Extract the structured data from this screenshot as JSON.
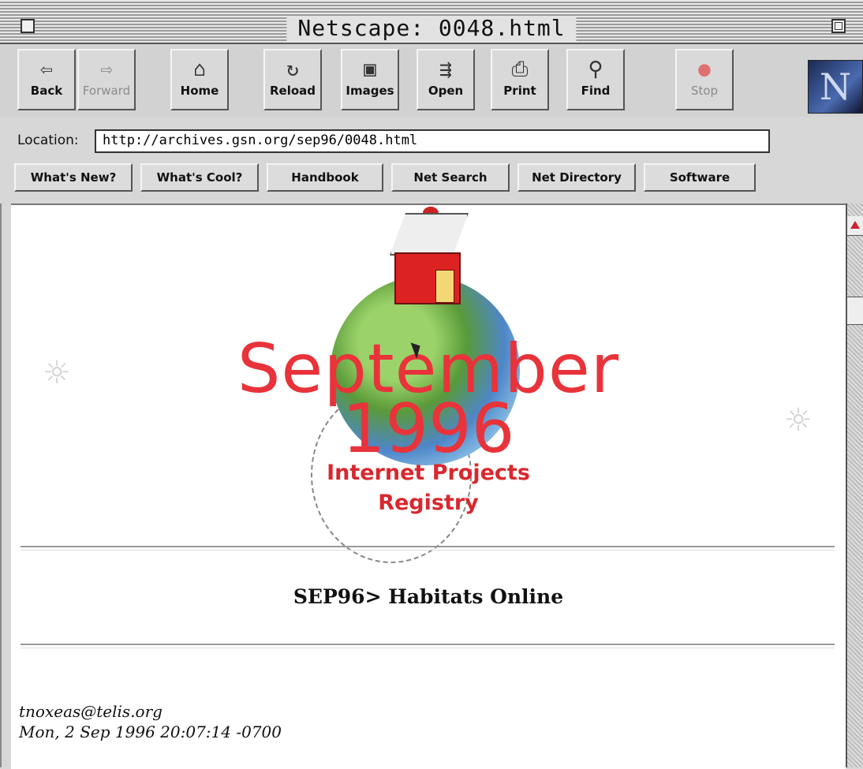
{
  "window": {
    "title": "Netscape: 0048.html"
  },
  "toolbar": {
    "buttons": [
      {
        "label": "Back",
        "icon": "back-arrow-icon",
        "glyph": "⇦",
        "enabled": true
      },
      {
        "label": "Forward",
        "icon": "forward-arrow-icon",
        "glyph": "⇨",
        "enabled": false
      },
      {
        "label": "Home",
        "icon": "home-icon",
        "glyph": "⌂",
        "enabled": true
      },
      {
        "label": "Reload",
        "icon": "reload-icon",
        "glyph": "↻",
        "enabled": true
      },
      {
        "label": "Images",
        "icon": "images-icon",
        "glyph": "▣",
        "enabled": true
      },
      {
        "label": "Open",
        "icon": "open-icon",
        "glyph": "⇶",
        "enabled": true
      },
      {
        "label": "Print",
        "icon": "print-icon",
        "glyph": "⎙",
        "enabled": true
      },
      {
        "label": "Find",
        "icon": "find-icon",
        "glyph": "⚲",
        "enabled": true
      },
      {
        "label": "Stop",
        "icon": "stop-icon",
        "glyph": "●",
        "enabled": false
      }
    ],
    "logo_letter": "N"
  },
  "location": {
    "label": "Location:",
    "url": "http://archives.gsn.org/sep96/0048.html"
  },
  "directory": [
    {
      "label": "What's New?"
    },
    {
      "label": "What's Cool?"
    },
    {
      "label": "Handbook"
    },
    {
      "label": "Net Search"
    },
    {
      "label": "Net Directory"
    },
    {
      "label": "Software"
    }
  ],
  "page": {
    "hero": {
      "month": "September",
      "year": "1996",
      "subtitle_line1": "Internet Projects",
      "subtitle_line2": "Registry",
      "accent_color": "#e8333a"
    },
    "project_title": "SEP96> Habitats Online",
    "footer": {
      "email": "tnoxeas@telis.org",
      "date": "Mon, 2 Sep 1996 20:07:14 -0700"
    }
  }
}
